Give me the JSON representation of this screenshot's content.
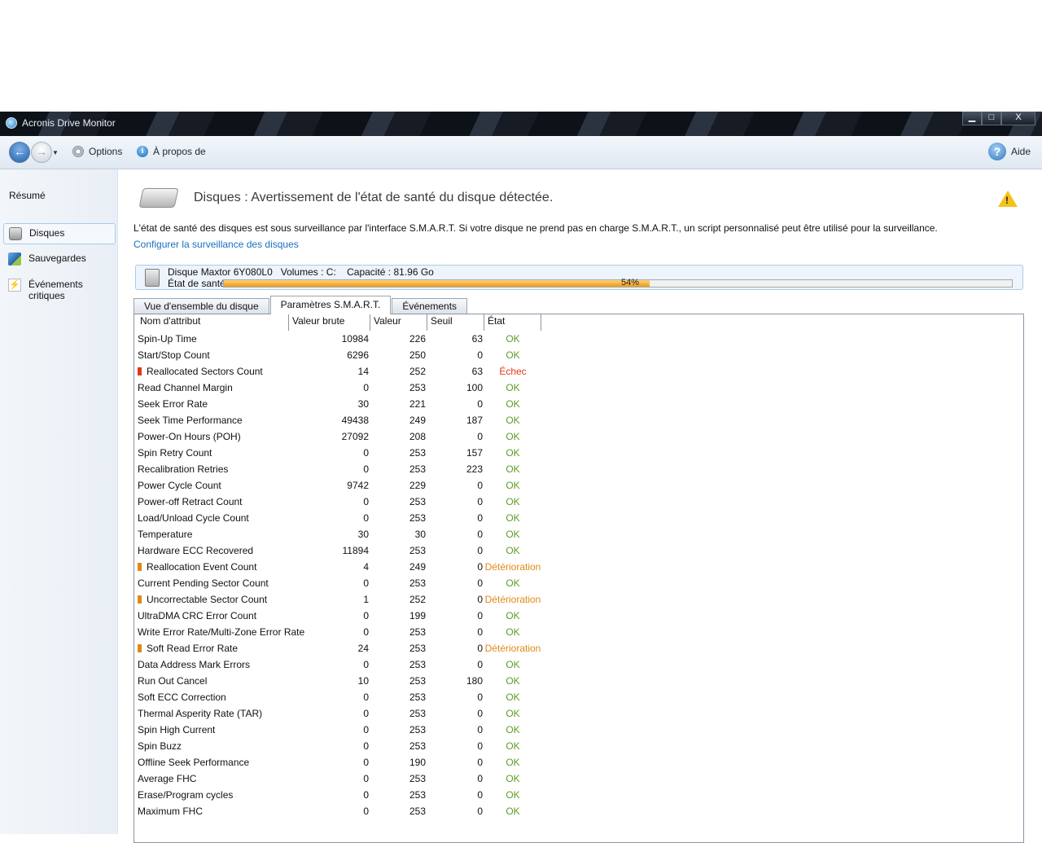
{
  "window": {
    "title": "Acronis Drive Monitor",
    "controls": {
      "minimize": "▁",
      "maximize": "□",
      "close": "X"
    }
  },
  "toolbar": {
    "options_label": "Options",
    "about_label": "À propos de",
    "help_label": "Aide",
    "help_glyph": "?",
    "info_glyph": "i"
  },
  "sidebar": {
    "summary_label": "Résumé",
    "items": [
      {
        "label": "Disques",
        "icon": "disk-icon",
        "active": true
      },
      {
        "label": "Sauvegardes",
        "icon": "backup-icon",
        "active": false
      },
      {
        "label": "Événements critiques",
        "icon": "critical-events-icon",
        "active": false
      }
    ]
  },
  "header": {
    "title": "Disques : Avertissement de l'état de santé du disque détectée.",
    "warning_glyph": "!",
    "intro": "L'état de santé des disques est sous surveillance par l'interface S.M.A.R.T. Si votre disque ne prend pas en charge S.M.A.R.T., un script personnalisé peut être utilisé pour la surveillance.",
    "config_link": "Configurer la surveillance des disques"
  },
  "disk": {
    "summary": "Disque Maxtor 6Y080L0   Volumes : C:    Capacité : 81.96 Go",
    "health_label": "État de santé :",
    "health_percent": 54,
    "health_text": "54%"
  },
  "tabs": [
    {
      "label": "Vue d'ensemble du disque",
      "active": false
    },
    {
      "label": "Paramètres S.M.A.R.T.",
      "active": true
    },
    {
      "label": "Événements",
      "active": false
    }
  ],
  "table": {
    "columns": [
      "Nom d'attribut",
      "Valeur brute",
      "Valeur",
      "Seuil",
      "État"
    ],
    "status_colors": {
      "ok": "#5d9b2a",
      "fail": "#e2381c",
      "warn": "#e08a16"
    },
    "rows": [
      {
        "name": "Spin-Up Time",
        "raw": "10984",
        "value": "226",
        "threshold": "63",
        "status": "OK",
        "level": "ok"
      },
      {
        "name": "Start/Stop Count",
        "raw": "6296",
        "value": "250",
        "threshold": "0",
        "status": "OK",
        "level": "ok"
      },
      {
        "name": "Reallocated Sectors Count",
        "raw": "14",
        "value": "252",
        "threshold": "63",
        "status": "Échec",
        "level": "fail"
      },
      {
        "name": "Read Channel Margin",
        "raw": "0",
        "value": "253",
        "threshold": "100",
        "status": "OK",
        "level": "ok"
      },
      {
        "name": "Seek Error Rate",
        "raw": "30",
        "value": "221",
        "threshold": "0",
        "status": "OK",
        "level": "ok"
      },
      {
        "name": "Seek Time Performance",
        "raw": "49438",
        "value": "249",
        "threshold": "187",
        "status": "OK",
        "level": "ok"
      },
      {
        "name": "Power-On Hours (POH)",
        "raw": "27092",
        "value": "208",
        "threshold": "0",
        "status": "OK",
        "level": "ok"
      },
      {
        "name": "Spin Retry Count",
        "raw": "0",
        "value": "253",
        "threshold": "157",
        "status": "OK",
        "level": "ok"
      },
      {
        "name": "Recalibration Retries",
        "raw": "0",
        "value": "253",
        "threshold": "223",
        "status": "OK",
        "level": "ok"
      },
      {
        "name": "Power Cycle Count",
        "raw": "9742",
        "value": "229",
        "threshold": "0",
        "status": "OK",
        "level": "ok"
      },
      {
        "name": "Power-off Retract Count",
        "raw": "0",
        "value": "253",
        "threshold": "0",
        "status": "OK",
        "level": "ok"
      },
      {
        "name": "Load/Unload Cycle Count",
        "raw": "0",
        "value": "253",
        "threshold": "0",
        "status": "OK",
        "level": "ok"
      },
      {
        "name": "Temperature",
        "raw": "30",
        "value": "30",
        "threshold": "0",
        "status": "OK",
        "level": "ok"
      },
      {
        "name": "Hardware ECC Recovered",
        "raw": "11894",
        "value": "253",
        "threshold": "0",
        "status": "OK",
        "level": "ok"
      },
      {
        "name": "Reallocation Event Count",
        "raw": "4",
        "value": "249",
        "threshold": "0",
        "status": "Détérioration",
        "level": "warn"
      },
      {
        "name": "Current Pending Sector Count",
        "raw": "0",
        "value": "253",
        "threshold": "0",
        "status": "OK",
        "level": "ok"
      },
      {
        "name": "Uncorrectable Sector Count",
        "raw": "1",
        "value": "252",
        "threshold": "0",
        "status": "Détérioration",
        "level": "warn"
      },
      {
        "name": "UltraDMA CRC Error Count",
        "raw": "0",
        "value": "199",
        "threshold": "0",
        "status": "OK",
        "level": "ok"
      },
      {
        "name": "Write Error Rate/Multi-Zone Error Rate",
        "raw": "0",
        "value": "253",
        "threshold": "0",
        "status": "OK",
        "level": "ok"
      },
      {
        "name": "Soft Read Error Rate",
        "raw": "24",
        "value": "253",
        "threshold": "0",
        "status": "Détérioration",
        "level": "warn"
      },
      {
        "name": "Data Address Mark Errors",
        "raw": "0",
        "value": "253",
        "threshold": "0",
        "status": "OK",
        "level": "ok"
      },
      {
        "name": "Run Out Cancel",
        "raw": "10",
        "value": "253",
        "threshold": "180",
        "status": "OK",
        "level": "ok"
      },
      {
        "name": "Soft ECC Correction",
        "raw": "0",
        "value": "253",
        "threshold": "0",
        "status": "OK",
        "level": "ok"
      },
      {
        "name": "Thermal Asperity Rate (TAR)",
        "raw": "0",
        "value": "253",
        "threshold": "0",
        "status": "OK",
        "level": "ok"
      },
      {
        "name": "Spin High Current",
        "raw": "0",
        "value": "253",
        "threshold": "0",
        "status": "OK",
        "level": "ok"
      },
      {
        "name": "Spin Buzz",
        "raw": "0",
        "value": "253",
        "threshold": "0",
        "status": "OK",
        "level": "ok"
      },
      {
        "name": "Offline Seek Performance",
        "raw": "0",
        "value": "190",
        "threshold": "0",
        "status": "OK",
        "level": "ok"
      },
      {
        "name": "Average FHC",
        "raw": "0",
        "value": "253",
        "threshold": "0",
        "status": "OK",
        "level": "ok"
      },
      {
        "name": "Erase/Program cycles",
        "raw": "0",
        "value": "253",
        "threshold": "0",
        "status": "OK",
        "level": "ok"
      },
      {
        "name": "Maximum FHC",
        "raw": "0",
        "value": "253",
        "threshold": "0",
        "status": "OK",
        "level": "ok"
      }
    ]
  }
}
